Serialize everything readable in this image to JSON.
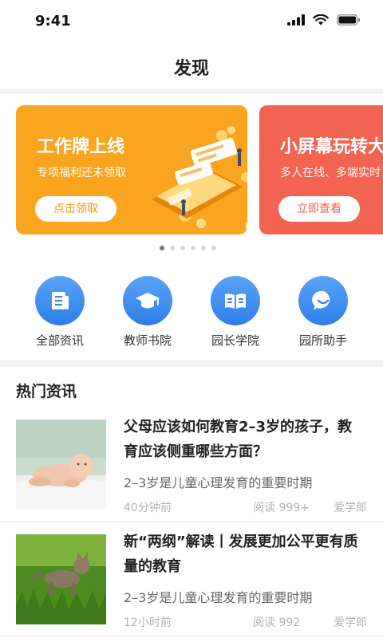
{
  "status_bar": {
    "time": "9:41",
    "icons": [
      "signal-icon",
      "wifi-icon",
      "battery-icon"
    ]
  },
  "nav": {
    "title": "发现"
  },
  "banners": [
    {
      "title": "工作牌上线",
      "subtitle": "专项福利还未领取",
      "button": "点击领取",
      "color": "#f9a51f"
    },
    {
      "title": "小屏幕玩转大",
      "subtitle": "多人在线、多端实时",
      "button": "立即查看",
      "color": "#f26352"
    }
  ],
  "carousel": {
    "page_count": 6,
    "active_index": 0
  },
  "quick_links": [
    {
      "label": "全部资讯",
      "icon": "document-icon"
    },
    {
      "label": "教师书院",
      "icon": "graduation-cap-icon"
    },
    {
      "label": "园长学院",
      "icon": "open-book-icon"
    },
    {
      "label": "园所助手",
      "icon": "chat-bubble-icon"
    }
  ],
  "section": {
    "title": "热门资讯"
  },
  "news": [
    {
      "title": "父母应该如何教育2–3岁的孩子，教育应该侧重哪些方面？",
      "desc": "2–3岁是儿童心理发育的重要时期",
      "time": "40分钟前",
      "reads": "阅读 999+",
      "source": "爱学郎",
      "thumb": "baby-photo"
    },
    {
      "title": "新“两纲”解读丨发展更加公平更有质量的教育",
      "desc": "2–3岁是儿童心理发育的重要时期",
      "time": "12小时前",
      "reads": "阅读 992",
      "source": "爱学郎",
      "thumb": "kitten-photo"
    }
  ],
  "colors": {
    "accent_blue": "#2f7fe9",
    "banner_orange": "#f9a51f",
    "banner_red": "#f26352"
  }
}
